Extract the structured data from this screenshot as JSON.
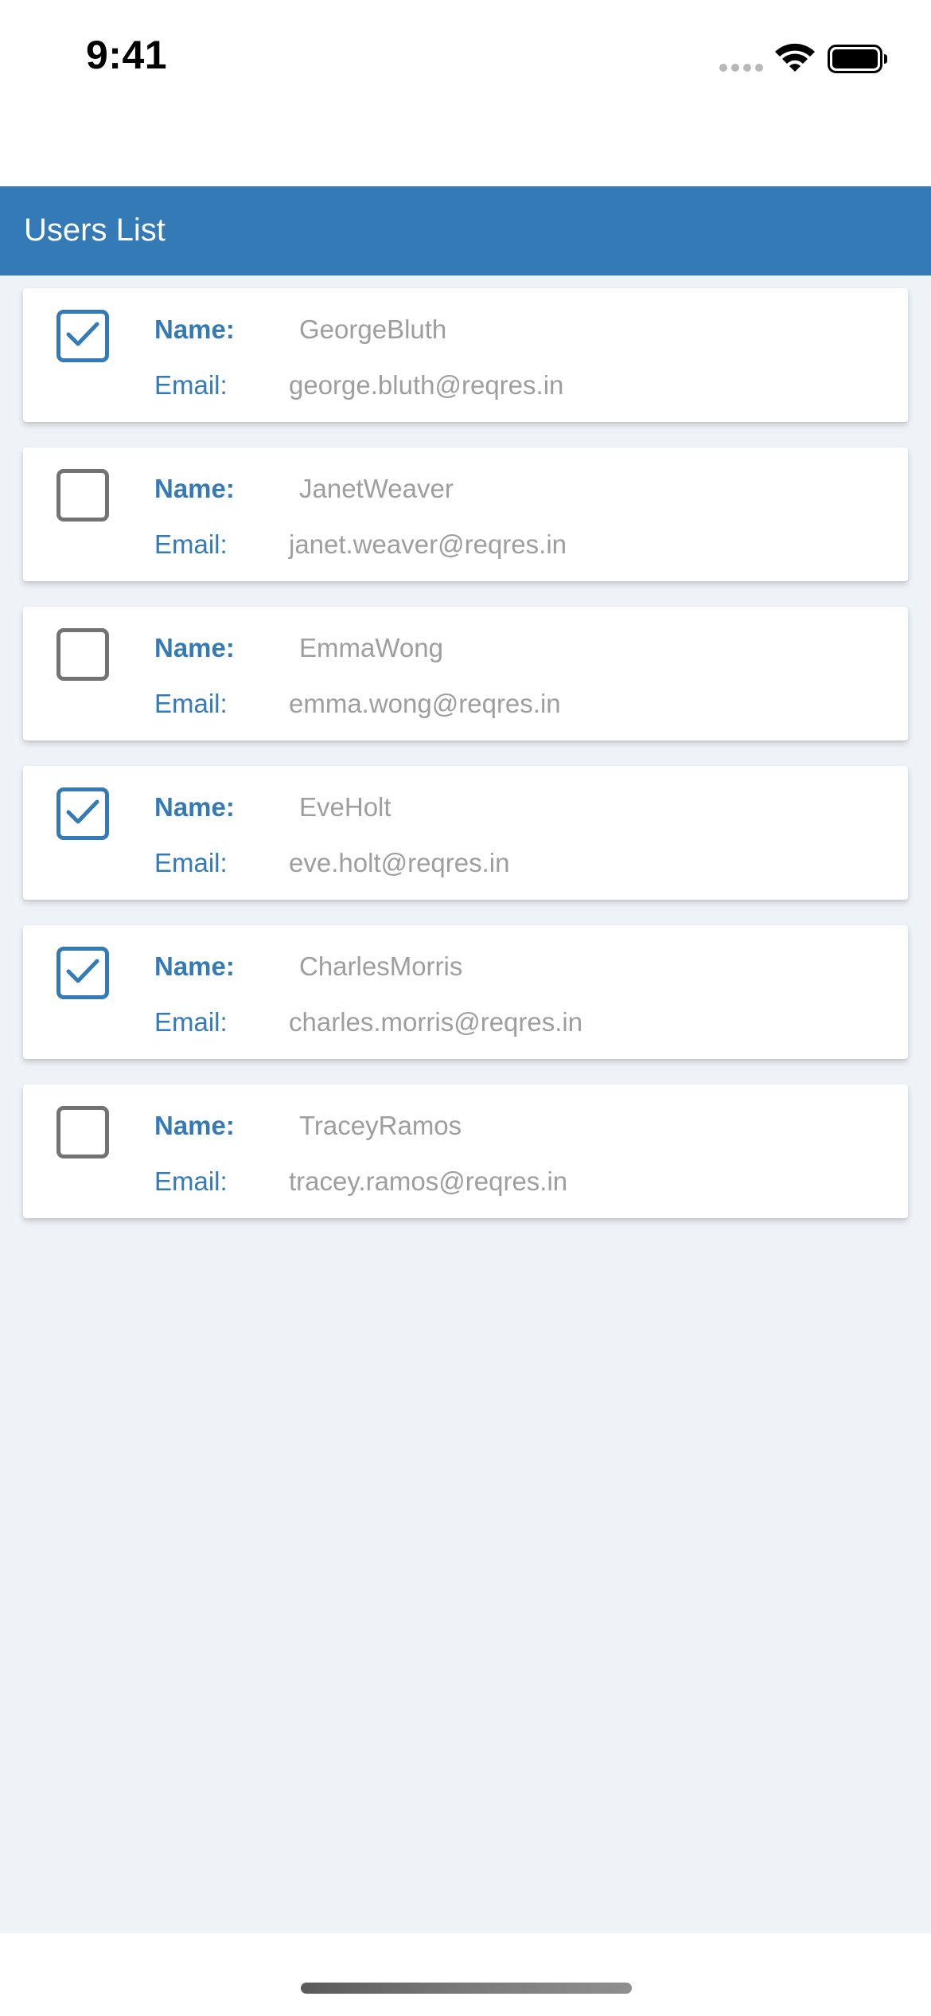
{
  "status_bar": {
    "time": "9:41",
    "icons": [
      "cellular-signal-icon",
      "wifi-icon",
      "battery-icon"
    ]
  },
  "header": {
    "title": "Users List"
  },
  "labels": {
    "name": "Name:",
    "email": "Email:"
  },
  "colors": {
    "accent": "#337ab7",
    "background": "#eef3f8",
    "value_text": "#9e9e9e",
    "unchecked_border": "#737373"
  },
  "users": [
    {
      "name": "GeorgeBluth",
      "email": "george.bluth@reqres.in",
      "checked": true
    },
    {
      "name": "JanetWeaver",
      "email": "janet.weaver@reqres.in",
      "checked": false
    },
    {
      "name": "EmmaWong",
      "email": "emma.wong@reqres.in",
      "checked": false
    },
    {
      "name": "EveHolt",
      "email": "eve.holt@reqres.in",
      "checked": true
    },
    {
      "name": "CharlesMorris",
      "email": "charles.morris@reqres.in",
      "checked": true
    },
    {
      "name": "TraceyRamos",
      "email": "tracey.ramos@reqres.in",
      "checked": false
    }
  ]
}
